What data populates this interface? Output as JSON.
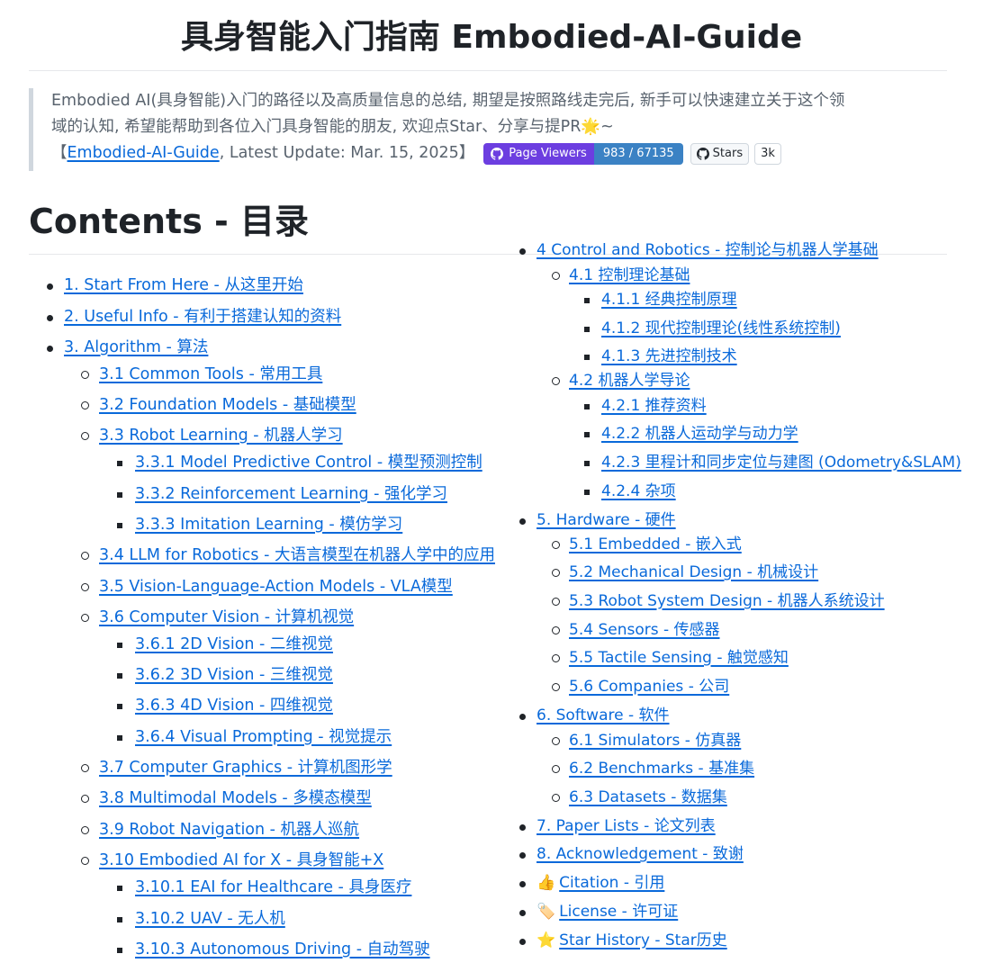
{
  "header": {
    "title": "具身智能入门指南 Embodied-AI-Guide"
  },
  "intro": {
    "line1": "Embodied AI(具身智能)入门的路径以及高质量信息的总结, 期望是按照路线走完后, 新手可以快速建立关于这个领",
    "line2": "域的认知, 希望能帮助到各位入门具身智能的朋友, 欢迎点Star、分享与提PR🌟~",
    "open_bracket": "【",
    "repo_link": "Embodied-AI-Guide",
    "update_text": ", Latest Update: Mar. 15, 2025",
    "close_bracket": "】",
    "badge_label": "Page Viewers",
    "badge_value": "983 / 67135",
    "stars_label": "Stars",
    "stars_count": "3k"
  },
  "contents": {
    "heading": "Contents - 目录",
    "left": [
      {
        "level": 1,
        "text": "1. Start From Here - 从这里开始"
      },
      {
        "level": 1,
        "text": "2. Useful Info - 有利于搭建认知的资料"
      },
      {
        "level": 1,
        "text": "3. Algorithm - 算法"
      },
      {
        "level": 2,
        "text": "3.1 Common Tools - 常用工具"
      },
      {
        "level": 2,
        "text": "3.2 Foundation Models - 基础模型"
      },
      {
        "level": 2,
        "text": "3.3 Robot Learning - 机器人学习"
      },
      {
        "level": 3,
        "text": "3.3.1 Model Predictive Control - 模型预测控制"
      },
      {
        "level": 3,
        "text": "3.3.2 Reinforcement Learning - 强化学习"
      },
      {
        "level": 3,
        "text": "3.3.3 Imitation Learning - 模仿学习"
      },
      {
        "level": 2,
        "text": "3.4 LLM for Robotics - 大语言模型在机器人学中的应用"
      },
      {
        "level": 2,
        "text": "3.5 Vision-Language-Action Models - VLA模型"
      },
      {
        "level": 2,
        "text": "3.6 Computer Vision - 计算机视觉"
      },
      {
        "level": 3,
        "text": "3.6.1 2D Vision - 二维视觉"
      },
      {
        "level": 3,
        "text": "3.6.2 3D Vision - 三维视觉"
      },
      {
        "level": 3,
        "text": "3.6.3 4D Vision - 四维视觉"
      },
      {
        "level": 3,
        "text": "3.6.4 Visual Prompting - 视觉提示"
      },
      {
        "level": 2,
        "text": "3.7 Computer Graphics - 计算机图形学"
      },
      {
        "level": 2,
        "text": "3.8 Multimodal Models - 多模态模型"
      },
      {
        "level": 2,
        "text": "3.9 Robot Navigation - 机器人巡航"
      },
      {
        "level": 2,
        "text": "3.10 Embodied AI for X - 具身智能+X"
      },
      {
        "level": 3,
        "text": "3.10.1 EAI for Healthcare - 具身医疗"
      },
      {
        "level": 3,
        "text": "3.10.2 UAV - 无人机"
      },
      {
        "level": 3,
        "text": "3.10.3 Autonomous Driving - 自动驾驶"
      }
    ],
    "right": [
      {
        "level": 1,
        "text": "4 Control and Robotics - 控制论与机器人学基础"
      },
      {
        "level": 2,
        "text": "4.1 控制理论基础"
      },
      {
        "level": 3,
        "text": "4.1.1 经典控制原理"
      },
      {
        "level": 3,
        "text": "4.1.2 现代控制理论(线性系统控制)"
      },
      {
        "level": 3,
        "text": "4.1.3 先进控制技术"
      },
      {
        "level": 2,
        "text": "4.2 机器人学导论"
      },
      {
        "level": 3,
        "text": "4.2.1 推荐资料"
      },
      {
        "level": 3,
        "text": "4.2.2 机器人运动学与动力学"
      },
      {
        "level": 3,
        "text": "4.2.3 里程计和同步定位与建图 (Odometry&SLAM)"
      },
      {
        "level": 3,
        "text": "4.2.4 杂项"
      },
      {
        "level": 1,
        "text": "5. Hardware - 硬件"
      },
      {
        "level": 2,
        "text": "5.1 Embedded - 嵌入式"
      },
      {
        "level": 2,
        "text": "5.2 Mechanical Design - 机械设计"
      },
      {
        "level": 2,
        "text": "5.3 Robot System Design - 机器人系统设计"
      },
      {
        "level": 2,
        "text": "5.4 Sensors - 传感器"
      },
      {
        "level": 2,
        "text": "5.5 Tactile Sensing - 触觉感知"
      },
      {
        "level": 2,
        "text": "5.6 Companies - 公司"
      },
      {
        "level": 1,
        "text": "6. Software - 软件"
      },
      {
        "level": 2,
        "text": "6.1 Simulators - 仿真器"
      },
      {
        "level": 2,
        "text": "6.2 Benchmarks - 基准集"
      },
      {
        "level": 2,
        "text": "6.3 Datasets - 数据集"
      },
      {
        "level": 1,
        "text": "7. Paper Lists - 论文列表"
      },
      {
        "level": 1,
        "text": "8. Acknowledgement - 致谢"
      },
      {
        "level": 1,
        "emoji": "👍",
        "text": "Citation - 引用"
      },
      {
        "level": 1,
        "emoji": "🏷️",
        "text": "License - 许可证"
      },
      {
        "level": 1,
        "emoji": "⭐",
        "text": "Star History - Star历史"
      }
    ]
  },
  "colors": {
    "link": "#0969da",
    "badge_left": "#6c3ee0",
    "badge_right": "#3b82c4"
  }
}
